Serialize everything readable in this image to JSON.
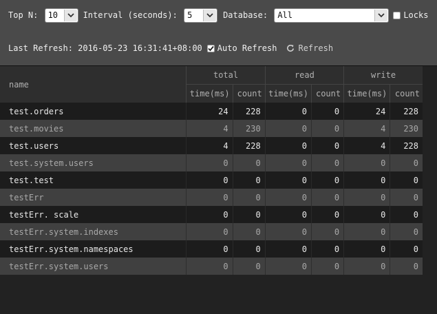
{
  "controls": {
    "top_n_label": "Top N: ",
    "top_n_value": "10",
    "interval_label": "Interval (seconds): ",
    "interval_value": "5",
    "database_label": "Database: ",
    "database_value": "All",
    "locks_label": "Locks",
    "locks_checked": false
  },
  "status": {
    "last_refresh_label": "Last Refresh: ",
    "last_refresh_value": "2016-05-23 16:31:41+08:00",
    "auto_refresh_label": "Auto Refresh",
    "auto_refresh_checked": true,
    "refresh_label": "Refresh"
  },
  "table": {
    "name_header": "name",
    "groups": [
      "total",
      "read",
      "write"
    ],
    "subheaders": [
      "time(ms)",
      "count",
      "time(ms)",
      "count",
      "time(ms)",
      "count"
    ],
    "rows": [
      {
        "name": "test.orders",
        "values": [
          "24",
          "228",
          "0",
          "0",
          "24",
          "228"
        ]
      },
      {
        "name": "test.movies",
        "values": [
          "4",
          "230",
          "0",
          "0",
          "4",
          "230"
        ]
      },
      {
        "name": "test.users",
        "values": [
          "4",
          "228",
          "0",
          "0",
          "4",
          "228"
        ]
      },
      {
        "name": "test.system.users",
        "values": [
          "0",
          "0",
          "0",
          "0",
          "0",
          "0"
        ]
      },
      {
        "name": "test.test",
        "values": [
          "0",
          "0",
          "0",
          "0",
          "0",
          "0"
        ]
      },
      {
        "name": "testErr",
        "values": [
          "0",
          "0",
          "0",
          "0",
          "0",
          "0"
        ]
      },
      {
        "name": "testErr. scale",
        "values": [
          "0",
          "0",
          "0",
          "0",
          "0",
          "0"
        ]
      },
      {
        "name": "testErr.system.indexes",
        "values": [
          "0",
          "0",
          "0",
          "0",
          "0",
          "0"
        ]
      },
      {
        "name": "testErr.system.namespaces",
        "values": [
          "0",
          "0",
          "0",
          "0",
          "0",
          "0"
        ]
      },
      {
        "name": "testErr.system.users",
        "values": [
          "0",
          "0",
          "0",
          "0",
          "0",
          "0"
        ]
      }
    ]
  },
  "colors": {
    "toolbar_bg": "#4a4a4a",
    "page_bg": "#222222",
    "row_dark": "#1c1c1c",
    "row_light": "#404040"
  }
}
